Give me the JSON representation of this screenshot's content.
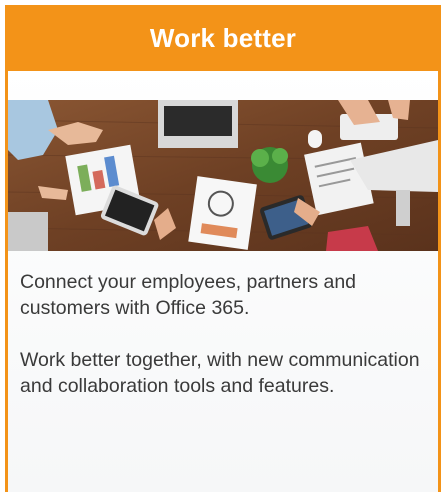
{
  "card": {
    "title": "Work better",
    "paragraphs": [
      "Connect your employees, partners and customers with Office 365.",
      "Work better together, with new communication and collaboration tools and features."
    ]
  },
  "colors": {
    "accent": "#f39318",
    "text": "#3a3a3a",
    "desk": "#7a4a2a"
  }
}
